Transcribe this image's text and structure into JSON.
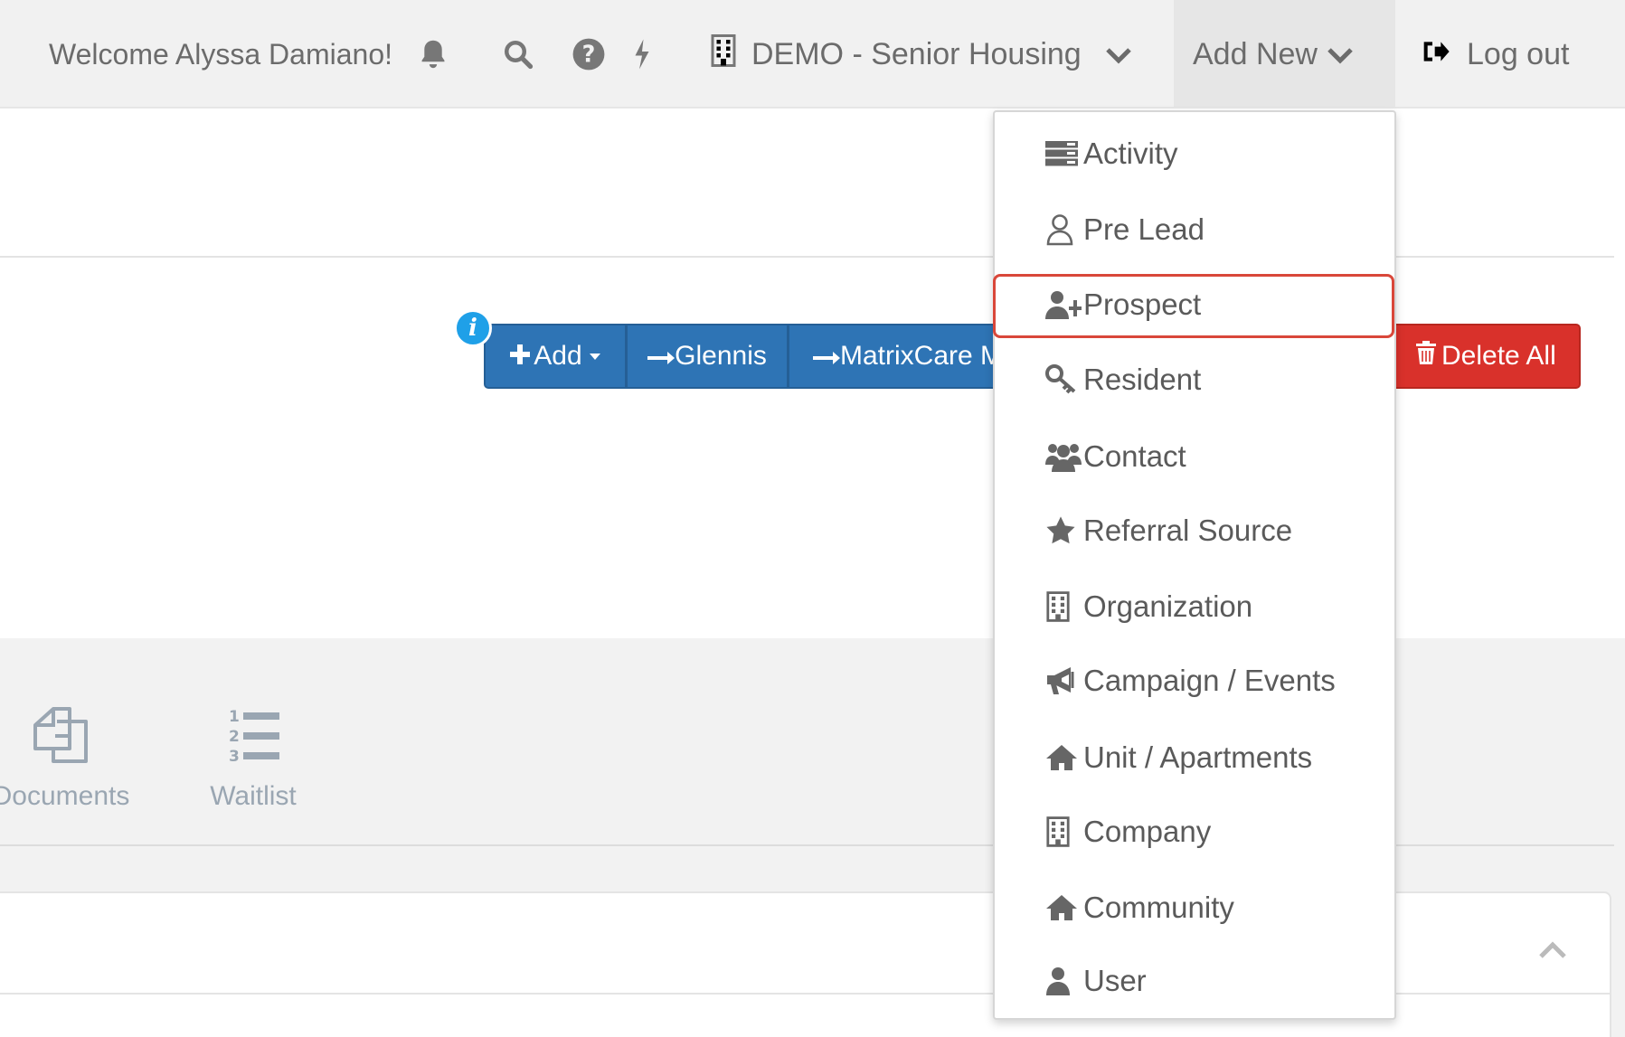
{
  "header": {
    "welcome": "Welcome Alyssa Damiano!",
    "community_selector": "DEMO - Senior Housing",
    "add_new": "Add New",
    "logout": "Log out",
    "icons": [
      "bell-icon",
      "search-icon",
      "help-icon",
      "bolt-icon",
      "building-icon"
    ]
  },
  "actions": {
    "info": "i",
    "add": "Add",
    "glennis": "Glennis",
    "matrixcare": "MatrixCare M",
    "delete_all": "Delete All"
  },
  "tabs": [
    {
      "label": "Documents",
      "icon": "documents-icon"
    },
    {
      "label": "Waitlist",
      "icon": "ordered-list-icon"
    }
  ],
  "add_new_menu": {
    "highlighted": "Prospect",
    "items": [
      {
        "label": "Activity",
        "icon": "activity-icon"
      },
      {
        "label": "Pre Lead",
        "icon": "user-outline-icon"
      },
      {
        "label": "Prospect",
        "icon": "user-plus-icon"
      },
      {
        "label": "Resident",
        "icon": "key-icon"
      },
      {
        "label": "Contact",
        "icon": "users-icon"
      },
      {
        "label": "Referral Source",
        "icon": "star-icon"
      },
      {
        "label": "Organization",
        "icon": "building-icon"
      },
      {
        "label": "Campaign / Events",
        "icon": "bullhorn-icon"
      },
      {
        "label": "Unit / Apartments",
        "icon": "home-icon"
      },
      {
        "label": "Company",
        "icon": "building-icon"
      },
      {
        "label": "Community",
        "icon": "home-icon"
      },
      {
        "label": "User",
        "icon": "user-icon"
      }
    ]
  },
  "colors": {
    "primary_button": "#2e74b5",
    "danger_button": "#d9312b",
    "info_badge": "#1fa0e8",
    "highlight_outline": "#d9473a"
  }
}
